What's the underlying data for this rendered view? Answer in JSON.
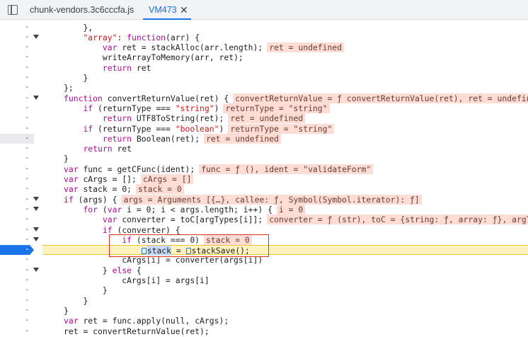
{
  "tabs": {
    "file1": "chunk-vendors.3c6cccfa.js",
    "file2": "VM473",
    "close": "✕"
  },
  "gutter_marker": "-",
  "code_lines": [
    {
      "text": "    },",
      "values": []
    },
    {
      "text": "    \"array\": function(arr) {",
      "values": []
    },
    {
      "text": "        var ret = stackAlloc(arr.length);",
      "values": [
        "ret = undefined"
      ]
    },
    {
      "text": "        writeArrayToMemory(arr, ret);",
      "values": []
    },
    {
      "text": "        return ret",
      "values": []
    },
    {
      "text": "    }",
      "values": []
    },
    {
      "text": "};",
      "values": []
    },
    {
      "text": "function convertReturnValue(ret) {",
      "values": [
        "convertReturnValue = ƒ convertReturnValue(ret), ret = undefined"
      ]
    },
    {
      "text": "    if (returnType === \"string\")",
      "values": [
        "returnType = \"string\""
      ]
    },
    {
      "text": "        return UTF8ToString(ret);",
      "values": [
        "ret = undefined"
      ]
    },
    {
      "text": "    if (returnType === \"boolean\")",
      "values": [
        "returnType = \"string\""
      ]
    },
    {
      "text": "        return Boolean(ret);",
      "values": [
        "ret = undefined"
      ]
    },
    {
      "text": "    return ret",
      "values": []
    },
    {
      "text": "}",
      "values": []
    },
    {
      "text": "var func = getCFunc(ident);",
      "values": [
        "func = ƒ (), ident = \"validateForm\""
      ]
    },
    {
      "text": "var cArgs = [];",
      "values": [
        "cArgs = []"
      ]
    },
    {
      "text": "var stack = 0;",
      "values": [
        "stack = 0"
      ]
    },
    {
      "text": "if (args) {",
      "values": [
        "args = Arguments [{…}, callee: ƒ, Symbol(Symbol.iterator): ƒ]"
      ]
    },
    {
      "text": "    for (var i = 0; i < args.length; i++) {",
      "values": [
        "i = 0"
      ]
    },
    {
      "text": "        var converter = toC[argTypes[i]];",
      "values": [
        "converter = ƒ (str), toC = {string: ƒ, array: ƒ}, argTyp"
      ]
    },
    {
      "text": "        if (converter) {",
      "values": []
    },
    {
      "text": "            if (stack === 0)",
      "values": [
        "stack = 0"
      ]
    },
    {
      "text": "                stack = stackSave();",
      "values": [],
      "paused": true
    },
    {
      "text": "            cArgs[i] = converter(args[i])",
      "values": []
    },
    {
      "text": "        } else {",
      "values": []
    },
    {
      "text": "            cArgs[i] = args[i]",
      "values": []
    },
    {
      "text": "        }",
      "values": []
    },
    {
      "text": "    }",
      "values": []
    },
    {
      "text": "}",
      "values": []
    },
    {
      "text": "var ret = func.apply(null, cArgs);",
      "values": []
    },
    {
      "text": "ret = convertReturnValue(ret);",
      "values": []
    }
  ],
  "gutter_rows": [
    {
      "arrow": false
    },
    {
      "arrow": true
    },
    {
      "arrow": false
    },
    {
      "arrow": false
    },
    {
      "arrow": false
    },
    {
      "arrow": false
    },
    {
      "arrow": false
    },
    {
      "arrow": true
    },
    {
      "arrow": false
    },
    {
      "arrow": false
    },
    {
      "arrow": false
    },
    {
      "arrow": false,
      "soft": true
    },
    {
      "arrow": false
    },
    {
      "arrow": false
    },
    {
      "arrow": false
    },
    {
      "arrow": false
    },
    {
      "arrow": false
    },
    {
      "arrow": true
    },
    {
      "arrow": true
    },
    {
      "arrow": false
    },
    {
      "arrow": true
    },
    {
      "arrow": true
    },
    {
      "arrow": false,
      "breakpoint": true
    },
    {
      "arrow": false
    },
    {
      "arrow": true
    },
    {
      "arrow": false
    },
    {
      "arrow": false
    },
    {
      "arrow": false
    },
    {
      "arrow": false
    },
    {
      "arrow": false
    },
    {
      "arrow": false
    }
  ]
}
